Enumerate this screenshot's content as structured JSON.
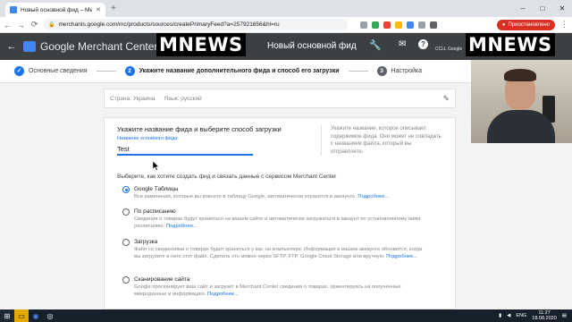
{
  "browser": {
    "tab_title": "Новый основной фид – Merch",
    "tab_close": "✕",
    "new_tab": "+",
    "window_controls": [
      "–",
      "□",
      "✕"
    ],
    "nav": [
      "←",
      "→",
      "⟳"
    ],
    "url": "merchants.google.com/mc/products/sources/createPrimaryFeed?a=257921656&hl=ru",
    "incognito_label": "Приостановлено",
    "menu": "⋮"
  },
  "gmc": {
    "back": "←",
    "title": "Google Merchant Center",
    "page_title": "Новый основной фид",
    "account_label": "CCLL Google",
    "watermark": "MNEWS"
  },
  "stepper": {
    "steps": [
      {
        "num": "✓",
        "label": "Основные сведения",
        "state": "done"
      },
      {
        "num": "2",
        "label": "Укажите название дополнительного фида и способ его загрузки",
        "state": "active"
      },
      {
        "num": "3",
        "label": "Настройка",
        "state": "pending"
      }
    ]
  },
  "country_row": {
    "country": "Страна: Украина",
    "language": "Язык: русский"
  },
  "form": {
    "heading": "Укажите название фида и выберите способ загрузки",
    "feed_label": "Название основного фида",
    "feed_value": "Test",
    "hint": "Укажите название, которое описывает содержимое фида. Оно может не совпадать с названием файла, который вы отправляете.",
    "choose_heading": "Выберите, как хотите создать фид и связать данные с сервисом Merchant Center",
    "options": [
      {
        "title": "Google Таблицы",
        "desc": "Все изменения, которые вы внесете в таблицу Google, автоматически отразятся в аккаунте.",
        "more": "Подробнее...",
        "selected": true
      },
      {
        "title": "По расписанию",
        "desc": "Сведения о товарах будут храниться на вашем сайте и автоматически загружаться в аккаунт по установленному вами расписанию.",
        "more": "Подробнее...",
        "selected": false
      },
      {
        "title": "Загрузка",
        "desc": "Файл со сведениями о товарах будет храниться у вас на компьютере. Информация в вашем аккаунте обновится, когда вы загрузите в него этот файл. Сделать это можно через SFTP, FTP, Google Cloud Storage или вручную.",
        "more": "Подробнее...",
        "selected": false
      },
      {
        "title": "Сканирование сайта",
        "desc": "Google просканирует ваш сайт и загрузит в Merchant Center сведения о товарах, ориентируясь на полученные микроданные и информацию.",
        "more": "Подробнее...",
        "selected": false
      }
    ]
  },
  "taskbar": {
    "lang": "ENG",
    "time": "11:27",
    "date": "18.08.2020"
  },
  "colors": {
    "accent": "#1a73e8",
    "header": "#3c4043",
    "done_step": "#1a73e8",
    "pending_step": "#5f6368"
  }
}
